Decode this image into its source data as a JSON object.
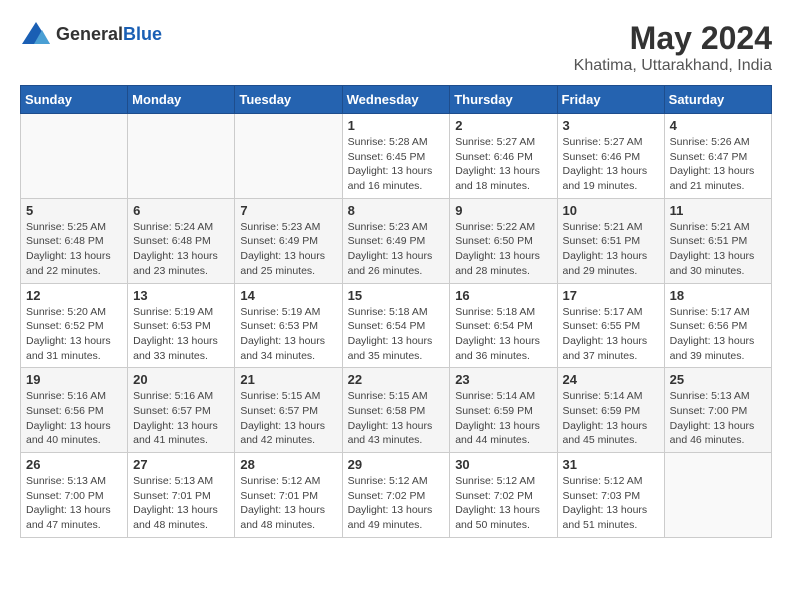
{
  "logo": {
    "general": "General",
    "blue": "Blue"
  },
  "title": {
    "month": "May 2024",
    "location": "Khatima, Uttarakhand, India"
  },
  "headers": [
    "Sunday",
    "Monday",
    "Tuesday",
    "Wednesday",
    "Thursday",
    "Friday",
    "Saturday"
  ],
  "weeks": [
    [
      {
        "day": "",
        "info": ""
      },
      {
        "day": "",
        "info": ""
      },
      {
        "day": "",
        "info": ""
      },
      {
        "day": "1",
        "info": "Sunrise: 5:28 AM\nSunset: 6:45 PM\nDaylight: 13 hours and 16 minutes."
      },
      {
        "day": "2",
        "info": "Sunrise: 5:27 AM\nSunset: 6:46 PM\nDaylight: 13 hours and 18 minutes."
      },
      {
        "day": "3",
        "info": "Sunrise: 5:27 AM\nSunset: 6:46 PM\nDaylight: 13 hours and 19 minutes."
      },
      {
        "day": "4",
        "info": "Sunrise: 5:26 AM\nSunset: 6:47 PM\nDaylight: 13 hours and 21 minutes."
      }
    ],
    [
      {
        "day": "5",
        "info": "Sunrise: 5:25 AM\nSunset: 6:48 PM\nDaylight: 13 hours and 22 minutes."
      },
      {
        "day": "6",
        "info": "Sunrise: 5:24 AM\nSunset: 6:48 PM\nDaylight: 13 hours and 23 minutes."
      },
      {
        "day": "7",
        "info": "Sunrise: 5:23 AM\nSunset: 6:49 PM\nDaylight: 13 hours and 25 minutes."
      },
      {
        "day": "8",
        "info": "Sunrise: 5:23 AM\nSunset: 6:49 PM\nDaylight: 13 hours and 26 minutes."
      },
      {
        "day": "9",
        "info": "Sunrise: 5:22 AM\nSunset: 6:50 PM\nDaylight: 13 hours and 28 minutes."
      },
      {
        "day": "10",
        "info": "Sunrise: 5:21 AM\nSunset: 6:51 PM\nDaylight: 13 hours and 29 minutes."
      },
      {
        "day": "11",
        "info": "Sunrise: 5:21 AM\nSunset: 6:51 PM\nDaylight: 13 hours and 30 minutes."
      }
    ],
    [
      {
        "day": "12",
        "info": "Sunrise: 5:20 AM\nSunset: 6:52 PM\nDaylight: 13 hours and 31 minutes."
      },
      {
        "day": "13",
        "info": "Sunrise: 5:19 AM\nSunset: 6:53 PM\nDaylight: 13 hours and 33 minutes."
      },
      {
        "day": "14",
        "info": "Sunrise: 5:19 AM\nSunset: 6:53 PM\nDaylight: 13 hours and 34 minutes."
      },
      {
        "day": "15",
        "info": "Sunrise: 5:18 AM\nSunset: 6:54 PM\nDaylight: 13 hours and 35 minutes."
      },
      {
        "day": "16",
        "info": "Sunrise: 5:18 AM\nSunset: 6:54 PM\nDaylight: 13 hours and 36 minutes."
      },
      {
        "day": "17",
        "info": "Sunrise: 5:17 AM\nSunset: 6:55 PM\nDaylight: 13 hours and 37 minutes."
      },
      {
        "day": "18",
        "info": "Sunrise: 5:17 AM\nSunset: 6:56 PM\nDaylight: 13 hours and 39 minutes."
      }
    ],
    [
      {
        "day": "19",
        "info": "Sunrise: 5:16 AM\nSunset: 6:56 PM\nDaylight: 13 hours and 40 minutes."
      },
      {
        "day": "20",
        "info": "Sunrise: 5:16 AM\nSunset: 6:57 PM\nDaylight: 13 hours and 41 minutes."
      },
      {
        "day": "21",
        "info": "Sunrise: 5:15 AM\nSunset: 6:57 PM\nDaylight: 13 hours and 42 minutes."
      },
      {
        "day": "22",
        "info": "Sunrise: 5:15 AM\nSunset: 6:58 PM\nDaylight: 13 hours and 43 minutes."
      },
      {
        "day": "23",
        "info": "Sunrise: 5:14 AM\nSunset: 6:59 PM\nDaylight: 13 hours and 44 minutes."
      },
      {
        "day": "24",
        "info": "Sunrise: 5:14 AM\nSunset: 6:59 PM\nDaylight: 13 hours and 45 minutes."
      },
      {
        "day": "25",
        "info": "Sunrise: 5:13 AM\nSunset: 7:00 PM\nDaylight: 13 hours and 46 minutes."
      }
    ],
    [
      {
        "day": "26",
        "info": "Sunrise: 5:13 AM\nSunset: 7:00 PM\nDaylight: 13 hours and 47 minutes."
      },
      {
        "day": "27",
        "info": "Sunrise: 5:13 AM\nSunset: 7:01 PM\nDaylight: 13 hours and 48 minutes."
      },
      {
        "day": "28",
        "info": "Sunrise: 5:12 AM\nSunset: 7:01 PM\nDaylight: 13 hours and 48 minutes."
      },
      {
        "day": "29",
        "info": "Sunrise: 5:12 AM\nSunset: 7:02 PM\nDaylight: 13 hours and 49 minutes."
      },
      {
        "day": "30",
        "info": "Sunrise: 5:12 AM\nSunset: 7:02 PM\nDaylight: 13 hours and 50 minutes."
      },
      {
        "day": "31",
        "info": "Sunrise: 5:12 AM\nSunset: 7:03 PM\nDaylight: 13 hours and 51 minutes."
      },
      {
        "day": "",
        "info": ""
      }
    ]
  ]
}
